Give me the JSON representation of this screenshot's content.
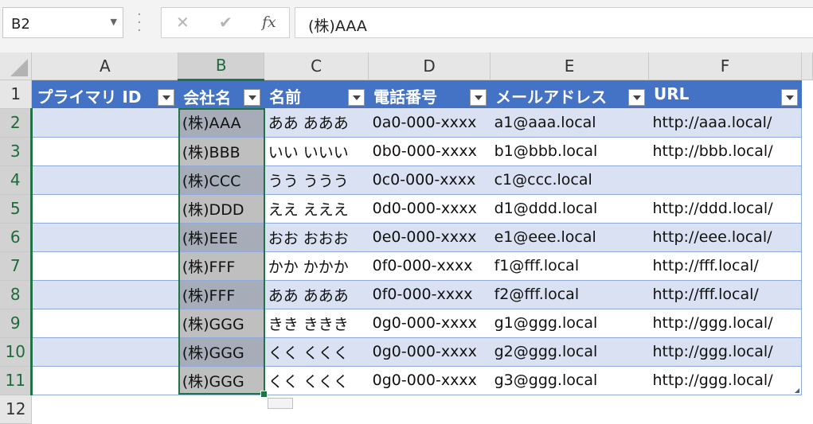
{
  "formula_bar": {
    "name_box": "B2",
    "content": "(株)AAA"
  },
  "columns": [
    "A",
    "B",
    "C",
    "D",
    "E",
    "F"
  ],
  "rows": [
    "1",
    "2",
    "3",
    "4",
    "5",
    "6",
    "7",
    "8",
    "9",
    "10",
    "11",
    "12"
  ],
  "headers": [
    "プライマリ ID",
    "会社名",
    "名前",
    "電話番号",
    "メールアドレス",
    "URL"
  ],
  "table": [
    [
      "",
      "(株)AAA",
      "ああ あああ",
      "0a0-000-xxxx",
      "a1@aaa.local",
      "http://aaa.local/"
    ],
    [
      "",
      "(株)BBB",
      "いい いいい",
      "0b0-000-xxxx",
      "b1@bbb.local",
      "http://bbb.local/"
    ],
    [
      "",
      "(株)CCC",
      "うう ううう",
      "0c0-000-xxxx",
      "c1@ccc.local",
      ""
    ],
    [
      "",
      "(株)DDD",
      "ええ えええ",
      "0d0-000-xxxx",
      "d1@ddd.local",
      "http://ddd.local/"
    ],
    [
      "",
      "(株)EEE",
      "おお おおお",
      "0e0-000-xxxx",
      "e1@eee.local",
      "http://eee.local/"
    ],
    [
      "",
      "(株)FFF",
      "かか かかか",
      "0f0-000-xxxx",
      "f1@fff.local",
      "http://fff.local/"
    ],
    [
      "",
      "(株)FFF",
      "ああ あああ",
      "0f0-000-xxxx",
      "f2@fff.local",
      "http://fff.local/"
    ],
    [
      "",
      "(株)GGG",
      "きき ききき",
      "0g0-000-xxxx",
      "g1@ggg.local",
      "http://ggg.local/"
    ],
    [
      "",
      "(株)GGG",
      "くく くくく",
      "0g0-000-xxxx",
      "g2@ggg.local",
      "http://ggg.local/"
    ],
    [
      "",
      "(株)GGG",
      "くく くくく",
      "0g0-000-xxxx",
      "g3@ggg.local",
      "http://ggg.local/"
    ]
  ],
  "colors": {
    "header_fill": "#4472c4",
    "band_fill": "#d9e1f2",
    "selection_border": "#217346"
  },
  "icons": [
    "cancel-icon",
    "enter-icon",
    "function-icon",
    "filter-dropdown-icon",
    "quick-analysis-icon"
  ]
}
